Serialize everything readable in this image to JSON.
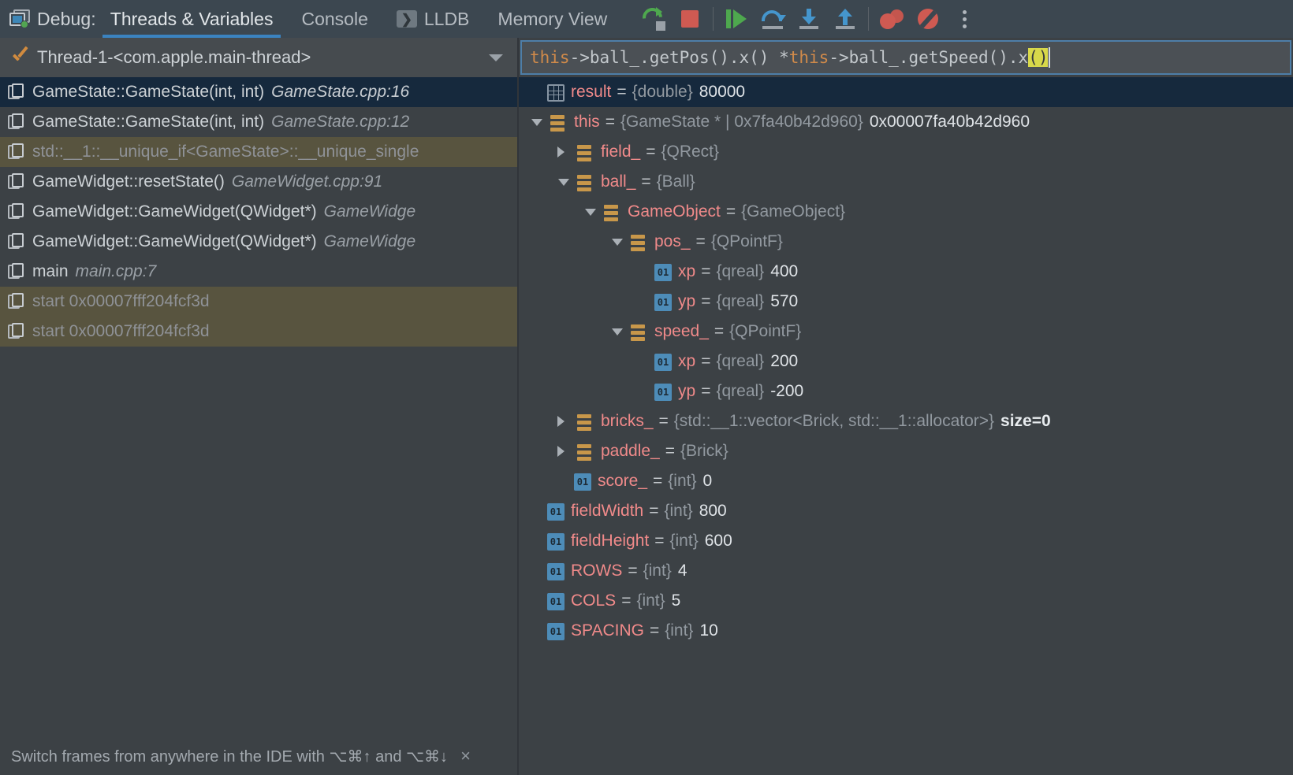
{
  "toolbar": {
    "app_label": "Debug:",
    "debug_icon": "debug-window-icon",
    "tabs": [
      {
        "label": "Threads & Variables",
        "active": true,
        "icon": null
      },
      {
        "label": "Console",
        "active": false,
        "icon": null
      },
      {
        "label": "LLDB",
        "active": false,
        "icon": "console-icon"
      },
      {
        "label": "Memory View",
        "active": false,
        "icon": null
      }
    ],
    "actions": [
      {
        "name": "rerun-button",
        "title": "Rerun"
      },
      {
        "name": "stop-button",
        "title": "Stop"
      },
      {
        "name": "resume-button",
        "title": "Resume Program"
      },
      {
        "name": "step-over-button",
        "title": "Step Over"
      },
      {
        "name": "step-into-button",
        "title": "Step Into"
      },
      {
        "name": "step-out-button",
        "title": "Step Out"
      },
      {
        "name": "view-breakpoints-button",
        "title": "View Breakpoints"
      },
      {
        "name": "mute-breakpoints-button",
        "title": "Mute Breakpoints"
      },
      {
        "name": "more-options-button",
        "title": "More"
      }
    ],
    "accent_color": "#3b83c0",
    "stop_color": "#cf5a52",
    "run_color": "#4ea84e",
    "step_color": "#4596cd"
  },
  "thread_selector": {
    "status_icon": "checkmark-icon",
    "value": "Thread-1-<com.apple.main-thread>",
    "dropdown_icon": "chevron-down-icon"
  },
  "expression": {
    "segments": [
      {
        "text": "this",
        "style": "keyword"
      },
      {
        "text": "->ball_.getPos().x() * ",
        "style": "plain"
      },
      {
        "text": "this",
        "style": "keyword"
      },
      {
        "text": "->ball_.getSpeed().x",
        "style": "plain"
      },
      {
        "text": "()",
        "style": "highlight"
      }
    ],
    "full_text": "this->ball_.getPos().x() * this->ball_.getSpeed().x()"
  },
  "frames": [
    {
      "fn": "GameState::GameState(int, int)",
      "loc": "GameState.cpp:16",
      "selected": true,
      "library": false
    },
    {
      "fn": "GameState::GameState(int, int)",
      "loc": "GameState.cpp:12",
      "selected": false,
      "library": false
    },
    {
      "fn": "std::__1::__unique_if<GameState>::__unique_single",
      "loc": "",
      "selected": false,
      "library": true
    },
    {
      "fn": "GameWidget::resetState()",
      "loc": "GameWidget.cpp:91",
      "selected": false,
      "library": false
    },
    {
      "fn": "GameWidget::GameWidget(QWidget*)",
      "loc": "GameWidge",
      "selected": false,
      "library": false
    },
    {
      "fn": "GameWidget::GameWidget(QWidget*)",
      "loc": "GameWidge",
      "selected": false,
      "library": false
    },
    {
      "fn": "main",
      "loc": "main.cpp:7",
      "selected": false,
      "library": false
    },
    {
      "fn": "start 0x00007fff204fcf3d",
      "loc": "",
      "selected": false,
      "library": true
    },
    {
      "fn": "start 0x00007fff204fcf3d",
      "loc": "",
      "selected": false,
      "library": true
    }
  ],
  "variables": [
    {
      "indent": 0,
      "twisty": "none",
      "icon": "result",
      "name": "result",
      "type": "{double}",
      "value": "80000",
      "selected": true
    },
    {
      "indent": 0,
      "twisty": "open",
      "icon": "obj",
      "name": "this",
      "type": "{GameState * | 0x7fa40b42d960}",
      "value": "0x00007fa40b42d960",
      "selected": false
    },
    {
      "indent": 1,
      "twisty": "closed",
      "icon": "obj",
      "name": "field_",
      "type": "{QRect}",
      "value": "",
      "selected": false
    },
    {
      "indent": 1,
      "twisty": "open",
      "icon": "obj",
      "name": "ball_",
      "type": "{Ball}",
      "value": "",
      "selected": false
    },
    {
      "indent": 2,
      "twisty": "open",
      "icon": "obj",
      "name": "GameObject",
      "type": "{GameObject}",
      "value": "",
      "selected": false
    },
    {
      "indent": 3,
      "twisty": "open",
      "icon": "obj",
      "name": "pos_",
      "type": "{QPointF}",
      "value": "",
      "selected": false
    },
    {
      "indent": 4,
      "twisty": "none",
      "icon": "prim",
      "name": "xp",
      "type": "{qreal}",
      "value": "400",
      "selected": false
    },
    {
      "indent": 4,
      "twisty": "none",
      "icon": "prim",
      "name": "yp",
      "type": "{qreal}",
      "value": "570",
      "selected": false
    },
    {
      "indent": 3,
      "twisty": "open",
      "icon": "obj",
      "name": "speed_",
      "type": "{QPointF}",
      "value": "",
      "selected": false
    },
    {
      "indent": 4,
      "twisty": "none",
      "icon": "prim",
      "name": "xp",
      "type": "{qreal}",
      "value": "200",
      "selected": false
    },
    {
      "indent": 4,
      "twisty": "none",
      "icon": "prim",
      "name": "yp",
      "type": "{qreal}",
      "value": "-200",
      "selected": false
    },
    {
      "indent": 1,
      "twisty": "closed",
      "icon": "obj",
      "name": "bricks_",
      "type": "{std::__1::vector<Brick, std::__1::allocator>}",
      "value": "",
      "size": "size=0",
      "selected": false
    },
    {
      "indent": 1,
      "twisty": "closed",
      "icon": "obj",
      "name": "paddle_",
      "type": "{Brick}",
      "value": "",
      "selected": false
    },
    {
      "indent": 1,
      "twisty": "none",
      "icon": "prim",
      "name": "score_",
      "type": "{int}",
      "value": "0",
      "selected": false
    },
    {
      "indent": 0,
      "twisty": "none",
      "icon": "prim",
      "name": "fieldWidth",
      "type": "{int}",
      "value": "800",
      "selected": false
    },
    {
      "indent": 0,
      "twisty": "none",
      "icon": "prim",
      "name": "fieldHeight",
      "type": "{int}",
      "value": "600",
      "selected": false
    },
    {
      "indent": 0,
      "twisty": "none",
      "icon": "prim",
      "name": "ROWS",
      "type": "{int}",
      "value": "4",
      "selected": false
    },
    {
      "indent": 0,
      "twisty": "none",
      "icon": "prim",
      "name": "COLS",
      "type": "{int}",
      "value": "5",
      "selected": false
    },
    {
      "indent": 0,
      "twisty": "none",
      "icon": "prim",
      "name": "SPACING",
      "type": "{int}",
      "value": "10",
      "selected": false
    }
  ],
  "status": {
    "hint": "Switch frames from anywhere in the IDE with ⌥⌘↑ and ⌥⌘↓",
    "close_icon": "×"
  }
}
